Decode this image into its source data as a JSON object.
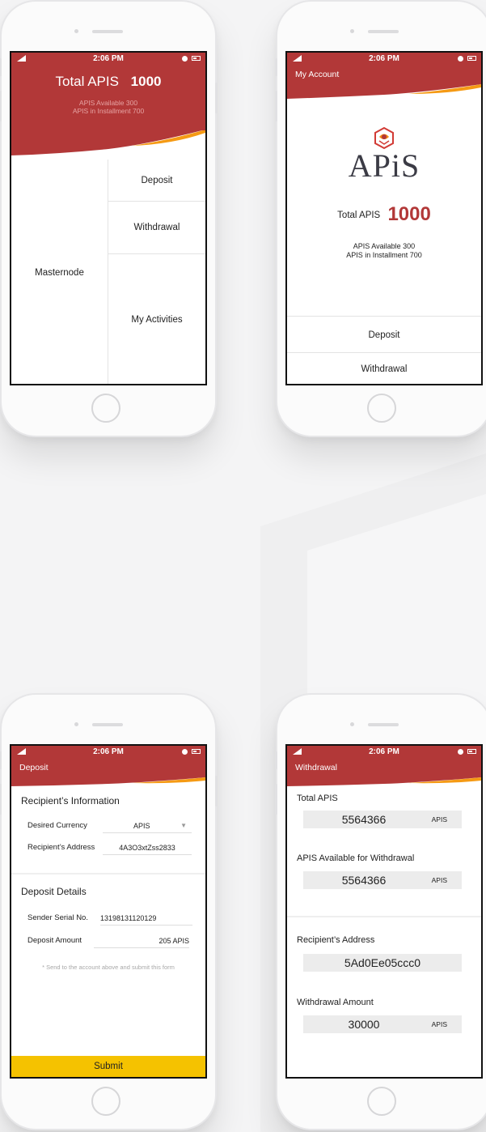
{
  "status_bar": {
    "time": "2:06 PM"
  },
  "dashboard": {
    "total_label": "Total APIS",
    "total_value": "1000",
    "available": "APIS Available  300",
    "installment": "APIS in Installment  700",
    "masternode": "Masternode",
    "deposit": "Deposit",
    "withdrawal": "Withdrawal",
    "my_activities": "My Activities"
  },
  "account": {
    "title": "My Account",
    "logo_text": "APiS",
    "total_label": "Total APIS",
    "total_value": "1000",
    "available": "APIS Available    300",
    "installment": "APIS in Installment    700",
    "deposit": "Deposit",
    "withdrawal": "Withdrawal"
  },
  "deposit": {
    "title": "Deposit",
    "recipient_section": "Recipient’s Information",
    "currency_label": "Desired Currency",
    "currency_value": "APIS",
    "address_label": "Recipient’s Address",
    "address_value": "4A3O3xtZss2833",
    "details_section": "Deposit Details",
    "serial_label": "Sender Serial No.",
    "serial_value": "13198131120129",
    "amount_label": "Deposit Amount",
    "amount_value": "205 APIS",
    "note": "* Send to the account above and submit this form",
    "submit": "Submit"
  },
  "withdrawal": {
    "title": "Withdrawal",
    "total_label": "Total APIS",
    "total_value": "5564366",
    "total_unit": "APIS",
    "available_label": "APIS Available for Withdrawal",
    "available_value": "5564366",
    "available_unit": "APIS",
    "address_label": "Recipient’s Address",
    "address_value": "5Ad0Ee05ccc0",
    "amount_label": "Withdrawal Amount",
    "amount_value": "30000",
    "amount_unit": "APIS"
  },
  "colors": {
    "brand_red": "#b23838",
    "accent_orange": "#f59a14",
    "submit_yellow": "#f5c200"
  }
}
